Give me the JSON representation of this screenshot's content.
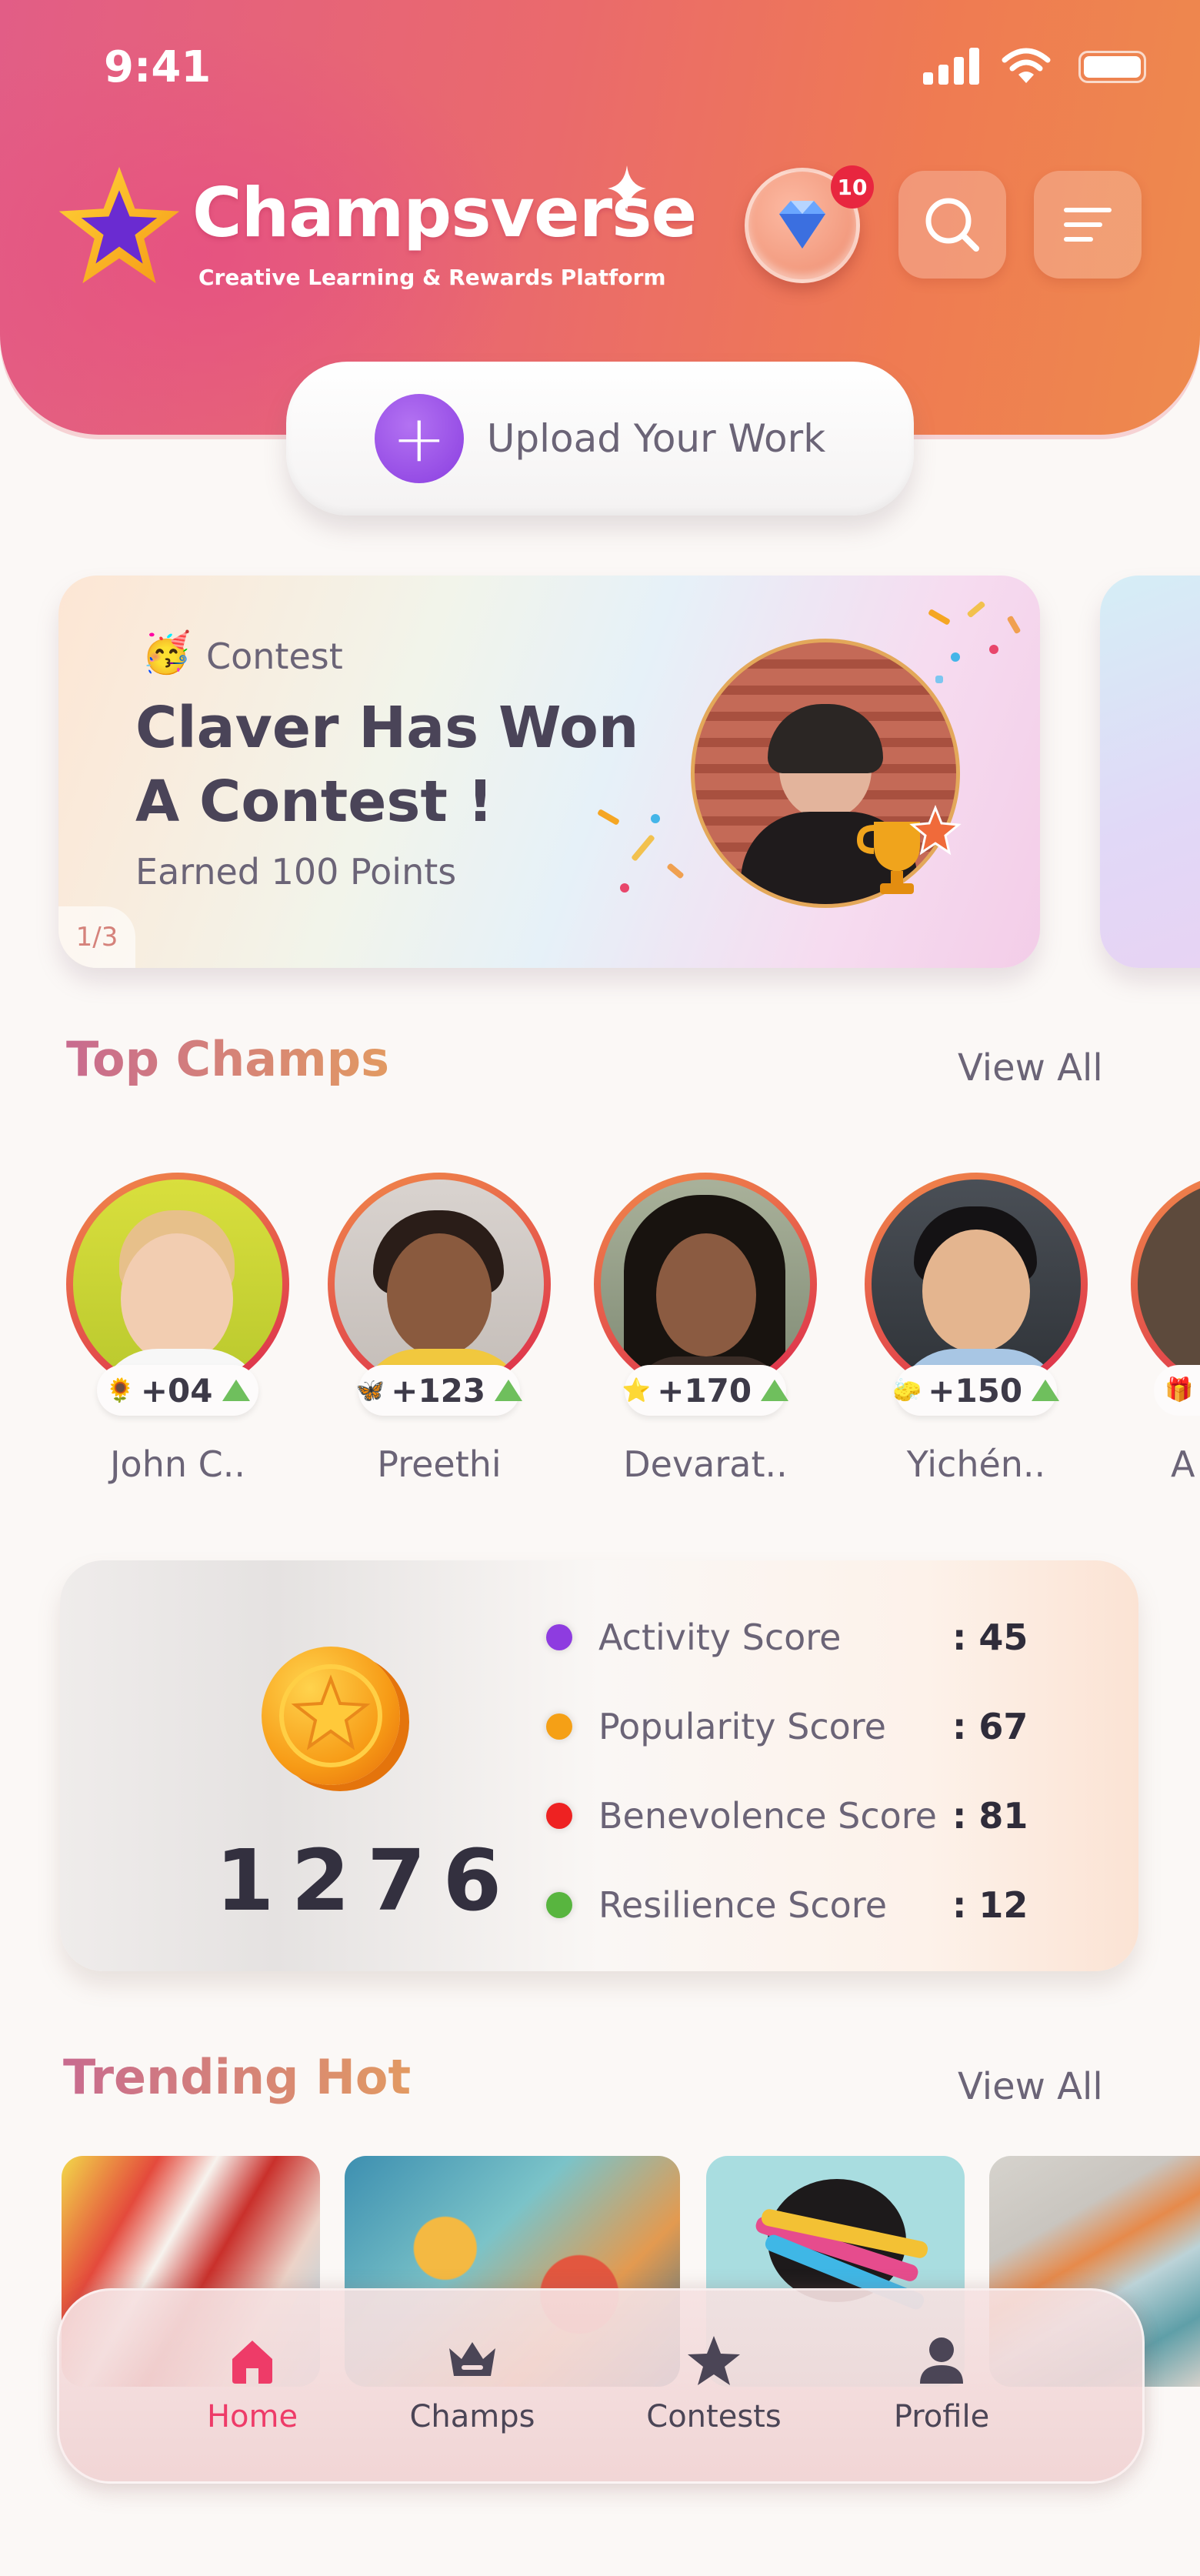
{
  "status_bar": {
    "time": "9:41"
  },
  "header": {
    "brand_name": "Champsverse",
    "brand_tagline": "Creative Learning & Rewards Platform",
    "notification_count": "10"
  },
  "upload": {
    "label": "Upload Your Work"
  },
  "contest_banner": {
    "tag": "Contest",
    "title": "Claver Has Won A Contest !",
    "subtitle": "Earned 100 Points",
    "page_indicator": "1/3"
  },
  "top_champs": {
    "title": "Top Champs",
    "view_all": "View All",
    "items": [
      {
        "name": "John C..",
        "points": "+04",
        "badge": "sunflower-icon"
      },
      {
        "name": "Preethi",
        "points": "+123",
        "badge": "butterfly-icon"
      },
      {
        "name": "Devarat..",
        "points": "+170",
        "badge": "star-icon"
      },
      {
        "name": "Yichén..",
        "points": "+150",
        "badge": "eraser-icon"
      },
      {
        "name": "A",
        "points": "",
        "badge": "gift-icon"
      }
    ]
  },
  "score_card": {
    "total": "1276",
    "rows": [
      {
        "label": "Activity Score",
        "value": ": 45",
        "color": "#8e3ce0"
      },
      {
        "label": "Popularity Score",
        "value": ": 67",
        "color": "#f5a016"
      },
      {
        "label": "Benevolence Score",
        "value": ": 81",
        "color": "#ee2222"
      },
      {
        "label": "Resilience Score",
        "value": ": 12",
        "color": "#58b53f"
      }
    ]
  },
  "trending": {
    "title": "Trending Hot",
    "view_all": "View All"
  },
  "bottom_nav": {
    "items": [
      {
        "label": "Home",
        "icon": "home-icon",
        "active": true
      },
      {
        "label": "Champs",
        "icon": "crown-icon",
        "active": false
      },
      {
        "label": "Contests",
        "icon": "star-icon",
        "active": false
      },
      {
        "label": "Profile",
        "icon": "user-icon",
        "active": false
      }
    ]
  },
  "colors": {
    "accent_pink": "#e25d86",
    "accent_orange": "#ef7b52",
    "active_nav": "#ee3b68",
    "upload_purple": "#8a3ee0"
  }
}
